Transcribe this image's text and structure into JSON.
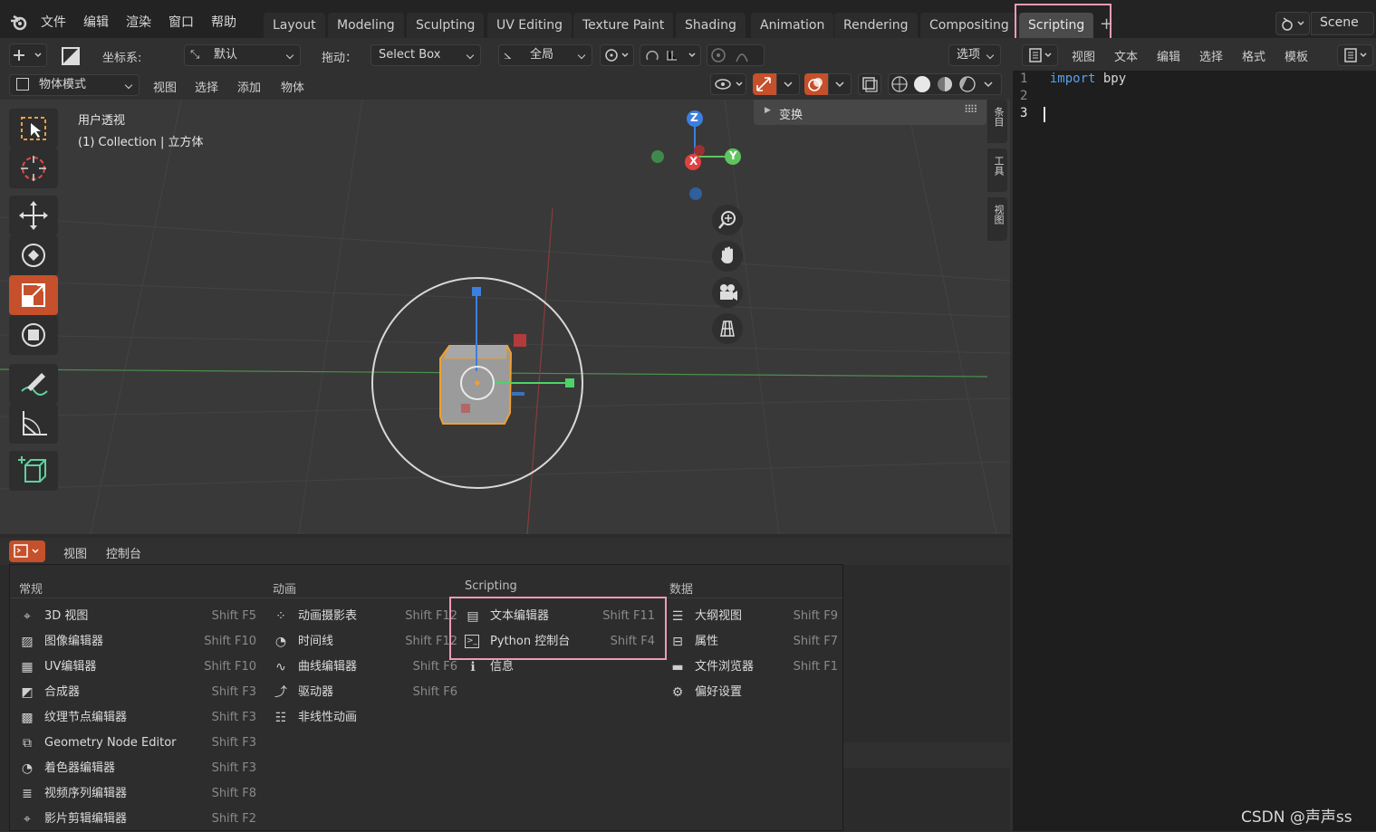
{
  "topbar": {
    "menus": [
      "文件",
      "编辑",
      "渲染",
      "窗口",
      "帮助"
    ],
    "tabs": [
      "Layout",
      "Modeling",
      "Sculpting",
      "UV Editing",
      "Texture Paint",
      "Shading",
      "Animation",
      "Rendering",
      "Compositing",
      "Scripting"
    ],
    "active_tab": "Scripting",
    "add_tab": "+",
    "scene": "Scene"
  },
  "header": {
    "coord_label": "坐标系:",
    "coord_value": "默认",
    "drag_label": "拖动：",
    "drag_value": "Select Box",
    "pivot_value": "全局",
    "options": "选项"
  },
  "viewport_header": {
    "mode": "物体模式",
    "menus": [
      "视图",
      "选择",
      "添加",
      "物体"
    ]
  },
  "viewport": {
    "view_name": "用户透视",
    "collection": "(1) Collection | 立方体",
    "transform_panel": "变换",
    "side_tabs": [
      "条目",
      "工具",
      "视图"
    ],
    "axes": {
      "x": "X",
      "y": "Y",
      "z": "Z"
    }
  },
  "texteditor": {
    "menus": [
      "视图",
      "文本",
      "编辑",
      "选择",
      "格式",
      "模板"
    ],
    "lines": [
      {
        "num": "1",
        "code_kw": "import",
        "code_rest": " bpy"
      },
      {
        "num": "2",
        "code_kw": "",
        "code_rest": ""
      },
      {
        "num": "3",
        "code_kw": "",
        "code_rest": ""
      }
    ]
  },
  "console_header": {
    "menus": [
      "视图",
      "控制台"
    ]
  },
  "editor_menu": {
    "columns": [
      {
        "title": "常规",
        "items": [
          {
            "icon": "3d-view-icon",
            "label": "3D 视图",
            "shortcut": "Shift F5"
          },
          {
            "icon": "image-editor-icon",
            "label": "图像编辑器",
            "shortcut": "Shift F10"
          },
          {
            "icon": "uv-editor-icon",
            "label": "UV编辑器",
            "shortcut": "Shift F10"
          },
          {
            "icon": "compositor-icon",
            "label": "合成器",
            "shortcut": "Shift F3"
          },
          {
            "icon": "texture-node-icon",
            "label": "纹理节点编辑器",
            "shortcut": "Shift F3"
          },
          {
            "icon": "geometry-node-icon",
            "label": "Geometry Node Editor",
            "shortcut": "Shift F3"
          },
          {
            "icon": "shader-editor-icon",
            "label": "着色器编辑器",
            "shortcut": "Shift F3"
          },
          {
            "icon": "sequencer-icon",
            "label": "视频序列编辑器",
            "shortcut": "Shift F8"
          },
          {
            "icon": "clip-editor-icon",
            "label": "影片剪辑编辑器",
            "shortcut": "Shift F2"
          }
        ]
      },
      {
        "title": "动画",
        "items": [
          {
            "icon": "dopesheet-icon",
            "label": "动画摄影表",
            "shortcut": "Shift F12"
          },
          {
            "icon": "timeline-icon",
            "label": "时间线",
            "shortcut": "Shift F12"
          },
          {
            "icon": "graph-editor-icon",
            "label": "曲线编辑器",
            "shortcut": "Shift F6"
          },
          {
            "icon": "drivers-icon",
            "label": "驱动器",
            "shortcut": "Shift F6"
          },
          {
            "icon": "nla-icon",
            "label": "非线性动画",
            "shortcut": ""
          }
        ]
      },
      {
        "title": "Scripting",
        "items": [
          {
            "icon": "text-editor-icon",
            "label": "文本编辑器",
            "shortcut": "Shift F11"
          },
          {
            "icon": "python-console-icon",
            "label": "Python 控制台",
            "shortcut": "Shift F4"
          },
          {
            "icon": "info-icon",
            "label": "信息",
            "shortcut": ""
          }
        ]
      },
      {
        "title": "数据",
        "items": [
          {
            "icon": "outliner-icon",
            "label": "大纲视图",
            "shortcut": "Shift F9"
          },
          {
            "icon": "properties-icon",
            "label": "属性",
            "shortcut": "Shift F7"
          },
          {
            "icon": "file-browser-icon",
            "label": "文件浏览器",
            "shortcut": "Shift F1"
          },
          {
            "icon": "preferences-icon",
            "label": "偏好设置",
            "shortcut": ""
          }
        ]
      }
    ]
  },
  "watermark": "CSDN @声声ss",
  "colors": {
    "accent": "#c5502b",
    "highlight_box": "#ef9ab8",
    "axis_x": "#e0413f",
    "axis_y": "#5ec45e",
    "axis_z": "#3c7fe0"
  }
}
